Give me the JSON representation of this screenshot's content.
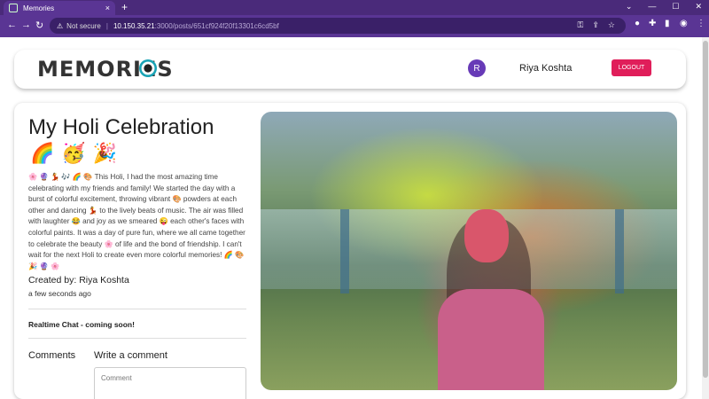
{
  "browser": {
    "tab_title": "Memories",
    "tab_close": "×",
    "new_tab": "+",
    "security": "Not secure",
    "url_host": "10.150.35.21",
    "url_path": ":3000/posts/651cf924f20f13301c6cd5bf"
  },
  "app": {
    "logo": "MEMORIES",
    "avatar_initial": "R",
    "user_name": "Riya Koshta",
    "logout_label": "LOGOUT"
  },
  "post": {
    "title": "My Holi Celebration",
    "title_emojis": "🌈🥳🎉",
    "message": "🌸 🔮 💃 🎶 🌈 🎨 This Holi, I had the most amazing time celebrating with my friends and family! We started the day with a burst of colorful excitement, throwing vibrant 🎨 powders at each other and dancing 💃 to the lively beats of music. The air was filled with laughter 😂 and joy as we smeared 😜 each other's faces with colorful paints. It was a day of pure fun, where we all came together to celebrate the beauty 🌸 of life and the bond of friendship. I can't wait for the next Holi to create even more colorful memories! 🌈 🎨 🎉 🔮 🌸",
    "created_by": "Created by: Riya Koshta",
    "time_ago": "a few seconds ago",
    "chat_label": "Realtime Chat - coming soon!",
    "comments_label": "Comments",
    "write_comment_label": "Write a comment",
    "comment_placeholder": "Comment"
  }
}
